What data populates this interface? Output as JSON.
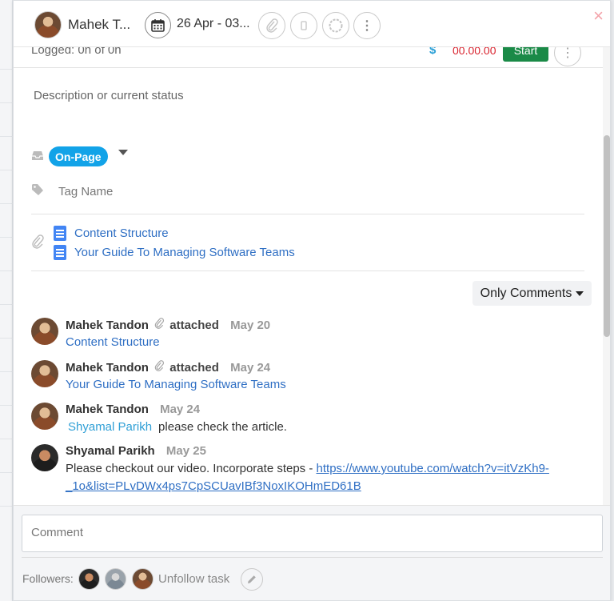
{
  "header": {
    "assignee_name": "Mahek T...",
    "date_range": "26 Apr - 03...",
    "close_icon": "close-icon"
  },
  "timer": {
    "logged_text": "Logged: 0h of 0h",
    "currency": "$",
    "amount": "00.00.00",
    "start_label": "Start"
  },
  "task": {
    "description_placeholder": "Description or current status",
    "list_label": "On-Page",
    "tag_placeholder": "Tag Name",
    "colors": {
      "list_pill": "#12a3e8",
      "start_button": "#1a8a47",
      "amount": "#d9232e"
    }
  },
  "attachments": [
    {
      "name": "Content Structure"
    },
    {
      "name": "Your Guide To Managing Software Teams"
    }
  ],
  "filter": {
    "label": "Only Comments"
  },
  "activity": [
    {
      "user": "Mahek Tandon",
      "verb": "attached",
      "date": "May 20",
      "link": "Content Structure"
    },
    {
      "user": "Mahek Tandon",
      "verb": "attached",
      "date": "May 24",
      "link": "Your Guide To Managing Software Teams"
    },
    {
      "user": "Mahek Tandon",
      "date": "May 24",
      "mention": "Shyamal Parikh",
      "text": "please check the article."
    },
    {
      "user": "Shyamal Parikh",
      "date": "May 25",
      "text": "Please checkout our video. Incorporate steps - ",
      "url_line1": "https://www.youtube.com/watch?v=itVzKh9-",
      "url_line2": "_1o&list=PLvDWx4ps7CpSCUavIBf3NoxIKOHmED61B"
    }
  ],
  "footer": {
    "comment_placeholder": "Comment",
    "followers_label": "Followers:",
    "unfollow_label": "Unfollow task"
  }
}
